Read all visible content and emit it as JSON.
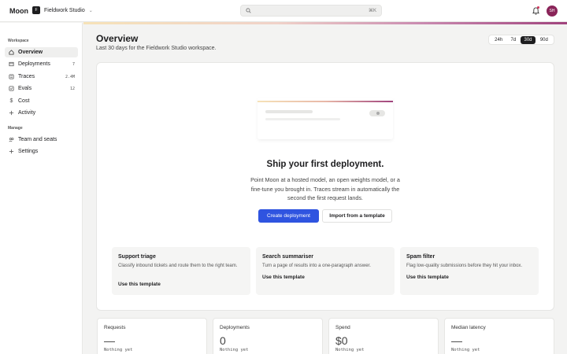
{
  "app": {
    "name": "Moon"
  },
  "workspace": {
    "badge": "F",
    "name": "Fieldwork Studio"
  },
  "search": {
    "shortcut": "⌘K"
  },
  "user": {
    "initials": "SH",
    "avatar_color": "#8a2459"
  },
  "sidebar": {
    "sections": [
      {
        "label": "Workspace"
      },
      {
        "label": "Manage"
      }
    ],
    "items": [
      {
        "label": "Overview",
        "icon": "home-icon",
        "count": ""
      },
      {
        "label": "Deployments",
        "icon": "box-icon",
        "count": "7"
      },
      {
        "label": "Traces",
        "icon": "traces-icon",
        "count": "2.4M"
      },
      {
        "label": "Evals",
        "icon": "evals-icon",
        "count": "12"
      },
      {
        "label": "Cost",
        "icon": "dollar-icon",
        "count": ""
      },
      {
        "label": "Activity",
        "icon": "activity-icon",
        "count": ""
      },
      {
        "label": "Team and seats",
        "icon": "team-icon",
        "count": ""
      },
      {
        "label": "Settings",
        "icon": "gear-icon",
        "count": ""
      }
    ]
  },
  "header": {
    "title": "Overview",
    "subtitle": "Last 30 days for the Fieldwork Studio workspace.",
    "ranges": [
      "24h",
      "7d",
      "30d",
      "90d"
    ],
    "selected_range": "30d"
  },
  "empty_state": {
    "title": "Ship your first deployment.",
    "body": "Point Moon at a hosted model, an open weights model, or a fine-tune you brought in. Traces stream in automatically the second the first request lands.",
    "primary_button": "Create deployment",
    "secondary_button": "Import from a template"
  },
  "templates": [
    {
      "title": "Support triage",
      "description": "Classify inbound tickets and route them to the right team.",
      "link": "Use this template"
    },
    {
      "title": "Search summariser",
      "description": "Turn a page of results into a one-paragraph answer.",
      "link": "Use this template"
    },
    {
      "title": "Spam filter",
      "description": "Flag low-quality submissions before they hit your inbox.",
      "link": "Use this template"
    }
  ],
  "metrics": [
    {
      "label": "Requests",
      "value": "—",
      "note": "Nothing yet"
    },
    {
      "label": "Deployments",
      "value": "0",
      "note": "Nothing yet"
    },
    {
      "label": "Spend",
      "value": "$0",
      "note": "Nothing yet"
    },
    {
      "label": "Median latency",
      "value": "—",
      "note": "Nothing yet"
    }
  ],
  "colors": {
    "primary": "#2f54e0",
    "accent_start": "#f6e2b8",
    "accent_end": "#a0437d",
    "notification": "#d1345b"
  }
}
